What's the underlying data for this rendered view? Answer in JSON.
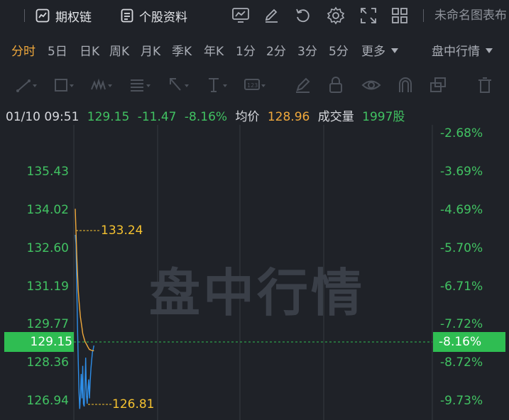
{
  "topbar": {
    "options_chain": "期权链",
    "stock_info": "个股资料",
    "untitled_layout": "未命名图表布"
  },
  "tabs": {
    "items": [
      "分时",
      "5日",
      "日K",
      "周K",
      "月K",
      "季K",
      "年K",
      "1分",
      "2分",
      "3分",
      "5分"
    ],
    "active": "分时",
    "more": "更多",
    "session": "盘中行情"
  },
  "info": {
    "time": "01/10 09:51",
    "price": "129.15",
    "change": "-11.47",
    "change_pct": "-8.16%",
    "avg_label": "均价",
    "avg_value": "128.96",
    "volume_label": "成交量",
    "volume_value": "1997股"
  },
  "chart": {
    "watermark": "盘中行情",
    "left_axis": [
      "135.43",
      "134.02",
      "132.60",
      "131.19",
      "129.77",
      "128.36",
      "126.94"
    ],
    "right_axis": [
      "-2.68%",
      "-3.69%",
      "-4.69%",
      "-5.70%",
      "-6.71%",
      "-7.72%",
      "-8.72%",
      "-9.73%"
    ],
    "current_price": "129.15",
    "current_pct": "-8.16%",
    "high_marker": "133.24",
    "low_marker": "126.81",
    "colors": {
      "price_line": "#2e8ee8",
      "avg_line": "#f0a93c",
      "up": "#41c262",
      "marker": "#f5c230"
    }
  },
  "chart_data": {
    "type": "line",
    "ylabel": "",
    "ylim": [
      126.4,
      137.3
    ],
    "series": [
      {
        "name": "",
        "x": [
          0,
          1,
          2,
          3,
          4,
          5,
          6,
          7,
          8,
          9,
          10,
          11,
          12,
          13,
          14,
          15,
          16,
          17,
          18,
          19,
          20,
          21,
          22,
          23,
          24,
          25
        ],
        "values": [
          133.24,
          132.9,
          131.4,
          129.8,
          128.6,
          127.4,
          126.81,
          127.3,
          128.1,
          127.2,
          128.4,
          127.0,
          126.9,
          127.6,
          128.7,
          127.3,
          127.0,
          127.5,
          127.9,
          127.2,
          127.8,
          128.3,
          128.6,
          128.9,
          129.0,
          129.15
        ]
      },
      {
        "name": "均价",
        "x": [
          0,
          1,
          2,
          3,
          4,
          5,
          6,
          7,
          8,
          9,
          10,
          11,
          12,
          13,
          14,
          15,
          16,
          17,
          18,
          19,
          20,
          21,
          22,
          23,
          24,
          25
        ],
        "values": [
          134.2,
          133.4,
          132.5,
          131.8,
          131.2,
          130.8,
          130.5,
          130.2,
          130.0,
          129.8,
          129.6,
          129.5,
          129.4,
          129.3,
          129.25,
          129.2,
          129.15,
          129.1,
          129.05,
          129.0,
          129.0,
          128.98,
          128.97,
          128.96,
          128.96,
          128.96
        ]
      }
    ]
  }
}
